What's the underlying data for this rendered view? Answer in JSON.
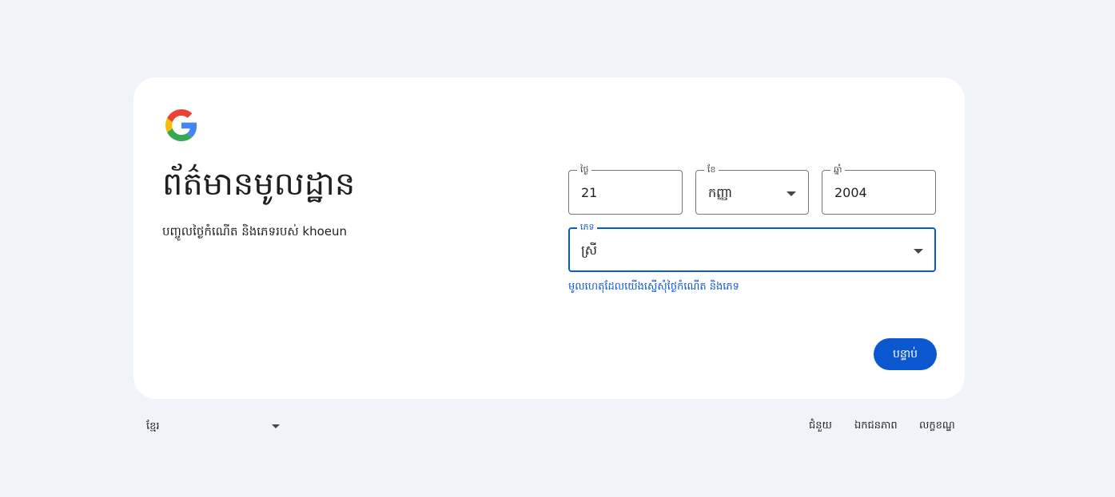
{
  "header": {
    "title": "ព័ត៌មានមូលដ្ឋាន",
    "subtitle": "បញ្ចូលថ្ងៃកំណើត និងភេទរបស់ khoeun"
  },
  "form": {
    "day": {
      "label": "ថ្ងៃ",
      "value": "21"
    },
    "month": {
      "label": "ខែ",
      "value": "កញ្ញា"
    },
    "year": {
      "label": "ឆ្នាំ",
      "value": "2004"
    },
    "gender": {
      "label": "ភេទ",
      "value": "ស្រី"
    },
    "helper_link": "មូលហេតុដែលយើងស្នើសុំថ្ងៃកំណើត និងភេទ",
    "next_label": "បន្ទាប់"
  },
  "footer": {
    "language": "ខ្មែរ",
    "links": [
      "ជំនួយ",
      "ឯកជនភាព",
      "លក្ខខណ្ឌ"
    ]
  },
  "colors": {
    "accent": "#0b57d0",
    "page_bg": "#f0f4f9",
    "card_bg": "#ffffff"
  },
  "icons": {
    "logo": "google-g-logo",
    "dropdown": "caret-down-icon"
  }
}
